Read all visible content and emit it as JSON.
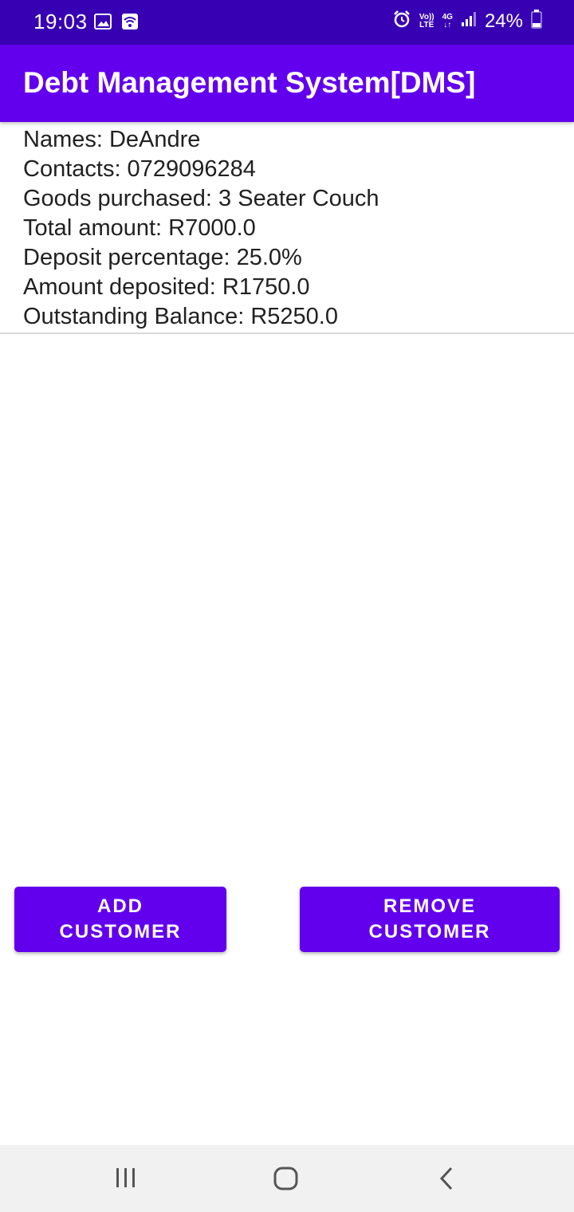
{
  "status_bar": {
    "time": "19:03",
    "battery": "24%",
    "icons": [
      "gallery-icon",
      "wifi-icon",
      "alarm-icon",
      "volte-icon",
      "4g-icon",
      "signal-icon",
      "battery-icon"
    ],
    "volte_line1": "Vo))",
    "volte_line2": "LTE",
    "network": "4G"
  },
  "app_bar": {
    "title": "Debt Management System[DMS]"
  },
  "customer": {
    "names": "Names: DeAndre",
    "contacts": "Contacts: 0729096284",
    "goods": "Goods purchased: 3 Seater Couch",
    "total": "Total amount: R7000.0",
    "deposit_pct": "Deposit percentage: 25.0%",
    "deposited": "Amount deposited: R1750.0",
    "balance": "Outstanding Balance: R5250.0"
  },
  "buttons": {
    "add_line1": "ADD",
    "add_line2": "CUSTOMER",
    "remove_line1": "REMOVE",
    "remove_line2": "CUSTOMER"
  },
  "nav_bar": {
    "icons": [
      "recent-apps-icon",
      "home-icon",
      "back-icon"
    ]
  },
  "colors": {
    "status_bar": "#3700b3",
    "primary": "#6200ee",
    "nav_bar": "#f1f1f1"
  }
}
